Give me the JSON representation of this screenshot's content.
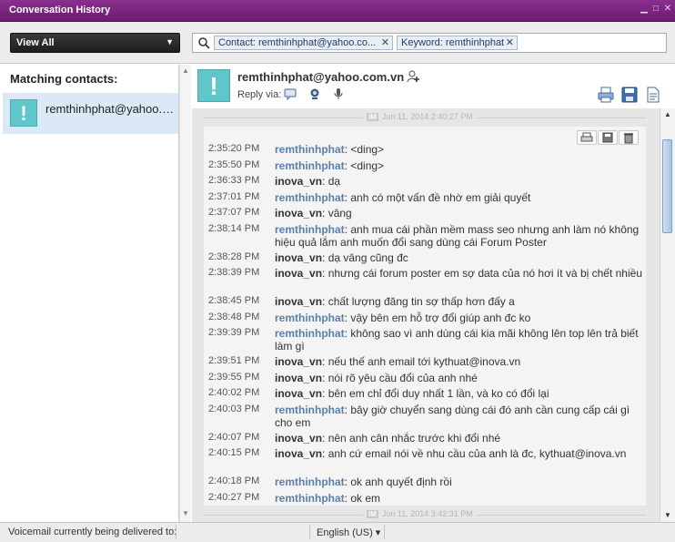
{
  "window": {
    "title": "Conversation History",
    "controls": [
      "minimize-icon",
      "maximize-icon",
      "close-icon"
    ]
  },
  "toolbar": {
    "view_filter": "View All",
    "search_chips": [
      {
        "label": "Contact: remthinhphat@yahoo.co...",
        "remove": "✕"
      },
      {
        "label": "Keyword: remthinhphat",
        "remove": "✕"
      }
    ]
  },
  "sidebar": {
    "header": "Matching contacts:",
    "contacts": [
      {
        "name": "remthinhphat@yahoo.…",
        "avatar": "!"
      }
    ]
  },
  "conversation": {
    "contact_email": "remthinhphat@yahoo.com.vn",
    "avatar": "!",
    "reply_via_label": "Reply via:",
    "reply_via_icons": [
      "im-icon",
      "webcam-icon",
      "microphone-icon"
    ],
    "actions": [
      "print-icon",
      "save-icon",
      "export-icon"
    ],
    "session": {
      "badge": "IM",
      "date": "Jun 11, 2014 2:40:27 PM",
      "card_actions": [
        "print-icon",
        "save-icon",
        "delete-icon"
      ],
      "messages": [
        {
          "time": "2:35:20 PM",
          "sender": "remthinhphat",
          "text": ": <ding>",
          "who": "a"
        },
        {
          "time": "2:35:50 PM",
          "sender": "remthinhphat",
          "text": ": <ding>",
          "who": "a"
        },
        {
          "time": "2:36:33 PM",
          "sender": "inova_vn",
          "text": ": dạ",
          "who": "b"
        },
        {
          "time": "2:37:01 PM",
          "sender": "remthinhphat",
          "text": ": anh có một vấn đề nhờ em giải quyết",
          "who": "a"
        },
        {
          "time": "2:37:07 PM",
          "sender": "inova_vn",
          "text": ": vâng",
          "who": "b"
        },
        {
          "time": "2:38:14 PM",
          "sender": "remthinhphat",
          "text": ": anh mua cái phần mềm mass seo nhưng anh làm nó không hiệu quả lắm anh muốn đổi sang dùng cái Forum Poster",
          "who": "a"
        },
        {
          "time": "2:38:28 PM",
          "sender": "inova_vn",
          "text": ": dạ vâng cũng đc",
          "who": "b"
        },
        {
          "time": "2:38:39 PM",
          "sender": "inova_vn",
          "text": ": nhưng cái forum poster em sợ data của nó hơi ít và bị chết nhiều",
          "who": "b"
        },
        {
          "time": "2:38:45 PM",
          "sender": "inova_vn",
          "text": ": chất lượng đăng tin sợ thấp hơn đấy a",
          "who": "b"
        },
        {
          "time": "2:38:48 PM",
          "sender": "remthinhphat",
          "text": ": vậy bên em hỗ trợ đổi giúp anh đc ko",
          "who": "a"
        },
        {
          "time": "2:39:39 PM",
          "sender": "remthinhphat",
          "text": ": không sao vì anh dùng cái kia mãi không lên top lên trả biết làm gì",
          "who": "a"
        },
        {
          "time": "2:39:51 PM",
          "sender": "inova_vn",
          "text": ": nếu thế anh email tới kythuat@inova.vn",
          "who": "b"
        },
        {
          "time": "2:39:55 PM",
          "sender": "inova_vn",
          "text": ": nói rõ yêu cầu đổi của anh nhé",
          "who": "b"
        },
        {
          "time": "2:40:02 PM",
          "sender": "inova_vn",
          "text": ": bên em chỉ đổi duy nhất 1 lần, và ko có đổi lại",
          "who": "b"
        },
        {
          "time": "2:40:03 PM",
          "sender": "remthinhphat",
          "text": ": bây giờ chuyển sang dùng cái đó anh cần cung cấp cái gì cho em",
          "who": "a"
        },
        {
          "time": "2:40:07 PM",
          "sender": "inova_vn",
          "text": ": nên anh cân nhắc trước khi đổi nhé",
          "who": "b"
        },
        {
          "time": "2:40:15 PM",
          "sender": "inova_vn",
          "text": ": anh cứ email nói về nhu cầu của anh là đc, kythuat@inova.vn",
          "who": "b"
        },
        {
          "time": "2:40:18 PM",
          "sender": "remthinhphat",
          "text": ": ok anh quyết định rồi",
          "who": "a"
        },
        {
          "time": "2:40:27 PM",
          "sender": "remthinhphat",
          "text": ": ok em",
          "who": "a"
        }
      ]
    },
    "next_session": {
      "badge": "IM",
      "date": "Jun 11, 2014 3:42:31 PM"
    }
  },
  "status": {
    "voicemail": "Voicemail currently being delivered to:",
    "language": "English (US)"
  }
}
